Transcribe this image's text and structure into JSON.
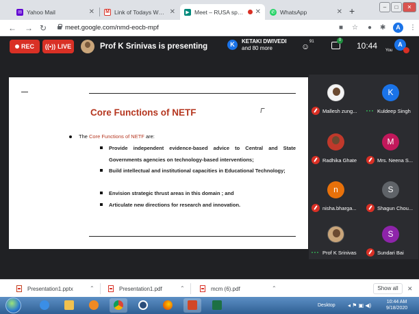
{
  "browser": {
    "tabs": [
      {
        "label": "Yahoo Mail",
        "icon": "mail-icon",
        "active": false
      },
      {
        "label": "Link of Todays Webinar : r",
        "icon": "gmail-icon",
        "active": false
      },
      {
        "label": "Meet – RUSA sponsor",
        "icon": "meet-icon",
        "active": true,
        "recording": true
      },
      {
        "label": "WhatsApp",
        "icon": "whatsapp-icon",
        "active": false
      }
    ],
    "url": "meet.google.com/nmd-eocb-mpf",
    "profile_initial": "A"
  },
  "meet": {
    "rec_label": "REC",
    "live_label": "LIVE",
    "presenting_text": "Prof K Srinivas is presenting",
    "attendee_initial": "K",
    "attendee_name": "KETAKI DWIVEDI",
    "attendee_more": "and 80 more",
    "people_count": "91",
    "chat_badge": "0",
    "clock": "10:44",
    "you_label": "You",
    "you_initial": "A"
  },
  "slide": {
    "title": "Core Functions of NETF",
    "lead_prefix": "The ",
    "lead_highlight": "Core Functions of NETF",
    "lead_suffix": " are:",
    "points": [
      "Provide independent evidence-based advice to Central and State Governments agencies on technology-based interventions;",
      "Build intellectual and institutional capacities in Educational Technology;",
      "Envision strategic thrust areas in this domain ; and",
      "Articulate new directions for research and innovation."
    ]
  },
  "participants": [
    {
      "name": "Mallesh zung...",
      "initial": "",
      "color": "#f4f4f4",
      "status": "muted"
    },
    {
      "name": "Kuldeep Singh",
      "initial": "K",
      "color": "#1a73e8",
      "status": "speaking"
    },
    {
      "name": "Radhika Ghate",
      "initial": "",
      "color": "#c0392b",
      "status": "muted"
    },
    {
      "name": "Mrs. Neena S...",
      "initial": "M",
      "color": "#c2185b",
      "status": "muted"
    },
    {
      "name": "nisha.bharga...",
      "initial": "n",
      "color": "#e8710a",
      "status": "muted"
    },
    {
      "name": "Shagun Chou...",
      "initial": "S",
      "color": "#5f6368",
      "status": "muted"
    },
    {
      "name": "Prof K Srinivas",
      "initial": "",
      "color": "#c9a57a",
      "status": "speaking"
    },
    {
      "name": "Sundari Bai",
      "initial": "S",
      "color": "#8e24aa",
      "status": "muted"
    }
  ],
  "downloads": {
    "items": [
      {
        "name": "Presentation1.pptx",
        "icon": "pptx-file-icon"
      },
      {
        "name": "Presentation1.pdf",
        "icon": "pdf-file-icon"
      },
      {
        "name": "mcm (6).pdf",
        "icon": "pdf-file-icon"
      }
    ],
    "show_all": "Show all"
  },
  "taskbar": {
    "desktop_label": "Desktop",
    "time": "10:44 AM",
    "date": "9/18/2020"
  }
}
